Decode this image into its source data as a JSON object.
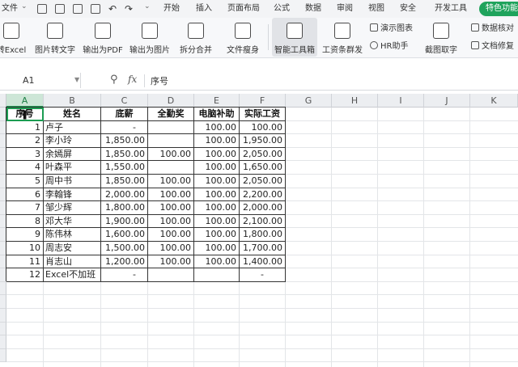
{
  "menubar": {
    "items": [
      "文件",
      "开始",
      "插入",
      "页面布局",
      "公式",
      "数据",
      "审阅",
      "视图",
      "安全",
      "开发工具"
    ],
    "special": "特色功能"
  },
  "ribbon": {
    "buttons": [
      "转Excel",
      "图片转文字",
      "输出为PDF",
      "输出为图片",
      "拆分合并",
      "文件瘦身",
      "智能工具箱",
      "工资条群发",
      "截图取字"
    ],
    "small_items": [
      "演示图表",
      "HR助手",
      "数据核对",
      "文档修复"
    ]
  },
  "formula_bar": {
    "name_box": "A1",
    "fx": "fx",
    "content": "序号"
  },
  "sheet": {
    "columns": [
      "A",
      "B",
      "C",
      "D",
      "E",
      "F",
      "G",
      "H",
      "I",
      "J",
      "K"
    ],
    "selected_column": "A",
    "headers": [
      "序号",
      "姓名",
      "底薪",
      "全勤奖",
      "电脑补助",
      "实际工资"
    ],
    "rows": [
      [
        "1",
        "卢子",
        "-",
        "",
        "100.00",
        "100.00"
      ],
      [
        "2",
        "李小玲",
        "1,850.00",
        "",
        "100.00",
        "1,950.00"
      ],
      [
        "3",
        "余嫣屏",
        "1,850.00",
        "100.00",
        "100.00",
        "2,050.00"
      ],
      [
        "4",
        "叶森平",
        "1,550.00",
        "",
        "100.00",
        "1,650.00"
      ],
      [
        "5",
        "周中书",
        "1,850.00",
        "100.00",
        "100.00",
        "2,050.00"
      ],
      [
        "6",
        "李翰锋",
        "2,000.00",
        "100.00",
        "100.00",
        "2,200.00"
      ],
      [
        "7",
        "邹少辉",
        "1,800.00",
        "100.00",
        "100.00",
        "2,000.00"
      ],
      [
        "8",
        "邓大华",
        "1,900.00",
        "100.00",
        "100.00",
        "2,100.00"
      ],
      [
        "9",
        "陈伟林",
        "1,600.00",
        "100.00",
        "100.00",
        "1,800.00"
      ],
      [
        "10",
        "周志安",
        "1,500.00",
        "100.00",
        "100.00",
        "1,700.00"
      ],
      [
        "11",
        "肖志山",
        "1,200.00",
        "100.00",
        "100.00",
        "1,400.00"
      ],
      [
        "12",
        "Excel不加班",
        "-",
        "",
        "",
        "-"
      ]
    ]
  },
  "colors": {
    "accent": "#1b9c52",
    "special_button": "#1fa35c"
  },
  "icons": [
    "save-icon",
    "print-icon",
    "undo-icon",
    "redo-icon",
    "zoom-icon",
    "fx-icon",
    "cursor-icon"
  ]
}
